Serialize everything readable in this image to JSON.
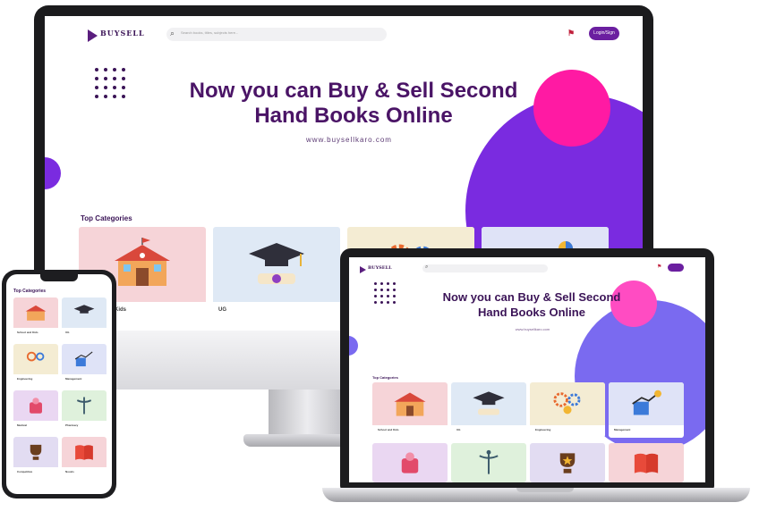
{
  "site": {
    "logo_text": "BUYSELL",
    "search_placeholder": "Search books, titles, subjects here...",
    "login_label": "Login/Sign",
    "hero_title": "Now you can Buy & Sell Second Hand Books Online",
    "hero_url": "www.buysellkaro.com",
    "section_title": "Top Categories"
  },
  "desktop": {
    "categories": [
      {
        "label": "School and Kids",
        "bg": "#f6d4d8",
        "icon": "school-building-icon"
      },
      {
        "label": "UG",
        "bg": "#dfe9f5",
        "icon": "graduation-cap-icon"
      },
      {
        "label": "",
        "bg": "#f4ecd3",
        "icon": "engineering-gears-icon"
      },
      {
        "label": "",
        "bg": "#dfe3f7",
        "icon": "management-chart-icon"
      }
    ]
  },
  "laptop": {
    "categories": [
      {
        "label": "School and Kids",
        "bg": "#f6d4d8",
        "icon": "school-building-icon"
      },
      {
        "label": "UG",
        "bg": "#dfe9f5",
        "icon": "graduation-cap-icon"
      },
      {
        "label": "Engineering",
        "bg": "#f4ecd3",
        "icon": "engineering-gears-icon"
      },
      {
        "label": "Management",
        "bg": "#dfe3f7",
        "icon": "management-chart-icon"
      },
      {
        "label": "",
        "bg": "#ead7f2",
        "icon": "medical-icon"
      },
      {
        "label": "",
        "bg": "#dff1dc",
        "icon": "caduceus-icon"
      },
      {
        "label": "",
        "bg": "#e2dcf2",
        "icon": "trophy-icon"
      },
      {
        "label": "",
        "bg": "#f6d4d8",
        "icon": "book-icon"
      }
    ]
  },
  "phone": {
    "categories": [
      {
        "label": "School and Kids",
        "bg": "#f6d4d8",
        "icon": "school-building-icon"
      },
      {
        "label": "UG",
        "bg": "#dfe9f5",
        "icon": "graduation-cap-icon"
      },
      {
        "label": "Engineering",
        "bg": "#f4ecd3",
        "icon": "engineering-gears-icon"
      },
      {
        "label": "Management",
        "bg": "#dfe3f7",
        "icon": "management-chart-icon"
      },
      {
        "label": "Medical",
        "bg": "#ead7f2",
        "icon": "medical-icon"
      },
      {
        "label": "Pharmacy",
        "bg": "#dff1dc",
        "icon": "caduceus-icon"
      },
      {
        "label": "Competitive",
        "bg": "#e2dcf2",
        "icon": "trophy-icon"
      },
      {
        "label": "Novels",
        "bg": "#f6d4d8",
        "icon": "book-icon"
      }
    ]
  },
  "colors": {
    "brand_purple": "#4a1466",
    "accent_violet": "#7a2be0",
    "accent_pink": "#ff1aa3"
  }
}
